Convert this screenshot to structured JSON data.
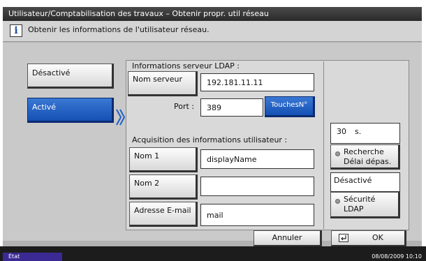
{
  "title": "Utilisateur/Comptabilisation des travaux – Obtenir propr. util réseau",
  "info": {
    "icon": "info-icon",
    "glyph": "i",
    "text": "Obtenir les informations de l'utilisateur réseau."
  },
  "mode": {
    "off_label": "Désactivé",
    "on_label": "Activé",
    "selected": "Activé"
  },
  "ldap": {
    "section_label": "Informations serveur LDAP :",
    "server_button": "Nom serveur",
    "server_value": "192.181.11.11",
    "port_label": "Port :",
    "port_value": "389",
    "keys_button": "TouchesN°"
  },
  "user_info": {
    "section_label": "Acquisition des informations utilisateur :",
    "name1_button": "Nom 1",
    "name1_value": "displayName",
    "name2_button": "Nom 2",
    "name2_value": "",
    "email_button": "Adresse E-mail",
    "email_value": "mail"
  },
  "search_timeout": {
    "value": "30",
    "unit": "s.",
    "button_line1": "Recherche",
    "button_line2": "Délai dépas."
  },
  "ldap_security": {
    "value": "Désactivé",
    "button_line1": "Sécurité",
    "button_line2": "LDAP"
  },
  "footer": {
    "cancel_label": "Annuler",
    "ok_label": "OK",
    "ok_icon": "enter-icon"
  },
  "status": {
    "label": "État",
    "datetime": "08/08/2009  10:10"
  },
  "colors": {
    "accent": "#1f5fc4",
    "titlebar": "#333333",
    "status_badge": "#3b2a93"
  }
}
